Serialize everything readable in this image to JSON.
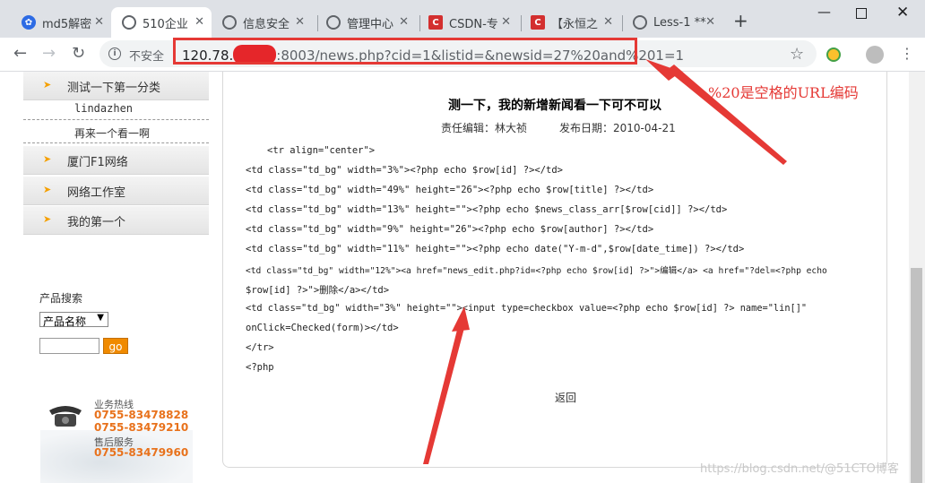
{
  "tabs": [
    {
      "title": "md5解密",
      "favicon": "paw-icon",
      "active": false
    },
    {
      "title": "510企业",
      "favicon": "globe-icon",
      "active": true
    },
    {
      "title": "信息安全",
      "favicon": "globe-icon",
      "active": false
    },
    {
      "title": "管理中心",
      "favicon": "globe-icon",
      "active": false
    },
    {
      "title": "CSDN-专",
      "favicon": "csdn-icon",
      "active": false
    },
    {
      "title": "【永恒之",
      "favicon": "csdn-icon",
      "active": false
    },
    {
      "title": "Less-1 **",
      "favicon": "globe-icon",
      "active": false
    }
  ],
  "toolbar": {
    "security_label": "不安全",
    "url_prefix": "120.78.",
    "url_suffix": ":8003/news.php?cid=1&listid=&newsid=27%20and%201=1"
  },
  "sidebar": {
    "top_item": "测试一下第一分类",
    "sub_items": [
      "lindazhen",
      "再来一个看一啊"
    ],
    "items": [
      "厦门F1网络",
      "网络工作室",
      "我的第一个"
    ]
  },
  "search": {
    "label": "产品搜索",
    "select_value": "产品名称",
    "go_label": "go"
  },
  "contact": {
    "hotline_label": "业务热线",
    "hotline_numbers": [
      "0755-83478828",
      "0755-83479210"
    ],
    "aftersales_label": "售后服务",
    "aftersales_number": "0755-83479960"
  },
  "article": {
    "title": "测一下，我的新增新闻看一下可不可以",
    "editor": "责任编辑：林大祯",
    "date": "发布日期：2010-04-21",
    "code_lines": [
      "<tr align=\"center\">",
      "<td class=\"td_bg\" width=\"3%\"><?php echo $row[id] ?></td>",
      "<td class=\"td_bg\" width=\"49%\" height=\"26\"><?php echo $row[title] ?></td>",
      "<td class=\"td_bg\" width=\"13%\" height=\"\"><?php echo $news_class_arr[$row[cid]] ?></td>",
      "<td class=\"td_bg\" width=\"9%\" height=\"26\"><?php echo $row[author] ?></td>",
      "<td class=\"td_bg\" width=\"11%\" height=\"\"><?php echo date(\"Y-m-d\",$row[date_time]) ?></td>",
      "<td class=\"td_bg\" width=\"12%\"><a href=\"news_edit.php?id=<?php echo $row[id] ?>\">编辑</a> <a href=\"?del=<?php echo",
      "$row[id] ?>\">删除</a></td>",
      "<td class=\"td_bg\" width=\"3%\" height=\"\"><input type=checkbox value=<?php echo $row[id] ?> name=\"lin[]\"",
      "onClick=Checked(form)></td>",
      "</tr>",
      "<?php"
    ],
    "back_label": "返回"
  },
  "annotation": {
    "note": "%20是空格的URL编码",
    "color": "#e53935"
  },
  "watermark": "https://blog.csdn.net/@51CTO博客"
}
